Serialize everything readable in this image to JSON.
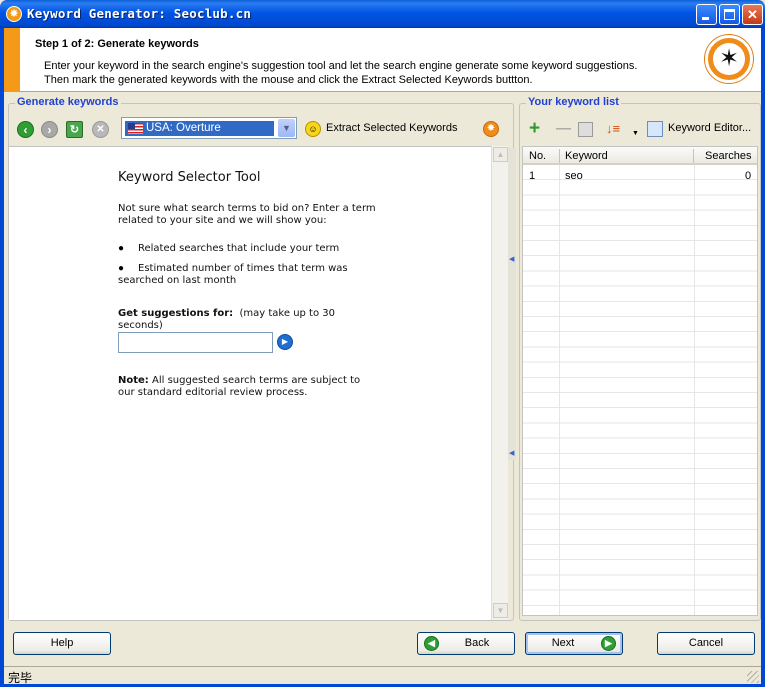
{
  "window": {
    "title": "Keyword Generator: Seoclub.cn",
    "title_icon": "app-star-icon",
    "controls": [
      "minimize",
      "maximize",
      "close"
    ]
  },
  "header": {
    "step_title": "Step 1 of 2: Generate keywords",
    "description": "Enter your keyword in the search engine's suggestion tool and let the search engine generate some keyword suggestions. Then mark the generated keywords with the mouse and click the Extract Selected Keywords buttton.",
    "stripe_color": "#f59a18"
  },
  "left_panel": {
    "label": "Generate keywords",
    "engine_selected": "USA: Overture",
    "extract_label": "Extract Selected Keywords",
    "icons": [
      "back-icon",
      "forward-icon",
      "refresh-icon",
      "stop-icon",
      "smiley-icon",
      "app-logo-icon"
    ]
  },
  "browser": {
    "title": "Keyword Selector Tool",
    "intro": "Not sure what search terms to bid on? Enter a term related to your site and we will show you:",
    "bullet1": "Related searches that include your term",
    "bullet2": "Estimated number of times that term was searched on last month",
    "suggest_label": "Get suggestions for:",
    "suggest_hint": "(may take up to 30 seconds)",
    "note_label": "Note:",
    "note_text": "All suggested search terms are subject to our standard editorial review process.",
    "input_value": ""
  },
  "right_panel": {
    "label": "Your keyword list",
    "editor_label": "Keyword Editor...",
    "columns": [
      "No.",
      "Keyword",
      "Searches"
    ],
    "rows": [
      {
        "no": "1",
        "keyword": "seo",
        "searches": "0"
      }
    ]
  },
  "buttons": {
    "help": "Help",
    "back": "Back",
    "next": "Next",
    "cancel": "Cancel"
  },
  "status": {
    "text": "完毕"
  },
  "colors": {
    "accent_blue": "#2240d0",
    "titlebar": "#0055e5",
    "selection": "#316ac5"
  }
}
